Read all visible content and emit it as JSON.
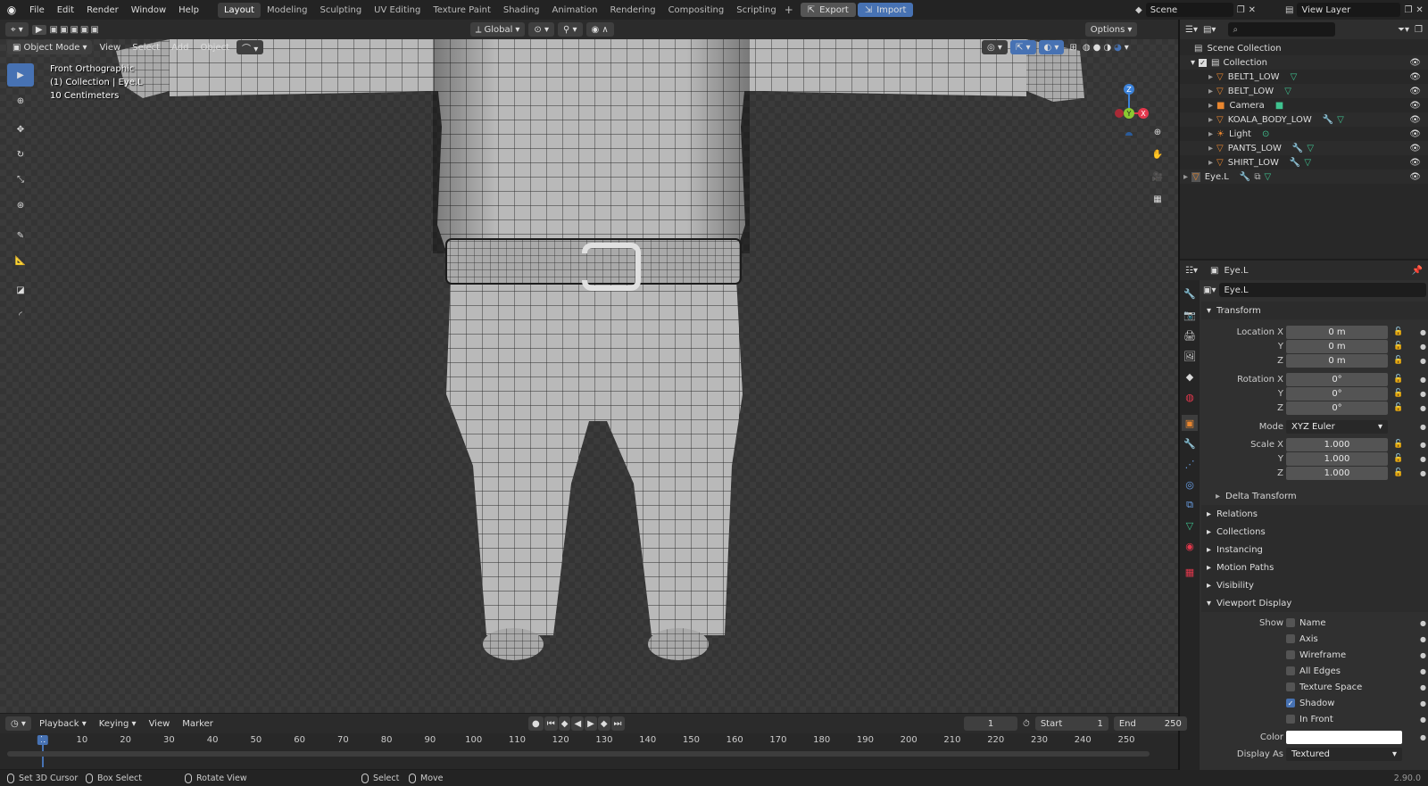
{
  "topbar": {
    "menus": [
      "File",
      "Edit",
      "Render",
      "Window",
      "Help"
    ],
    "workspaces": [
      "Layout",
      "Modeling",
      "Sculpting",
      "UV Editing",
      "Texture Paint",
      "Shading",
      "Animation",
      "Rendering",
      "Compositing",
      "Scripting"
    ],
    "active_workspace": "Layout",
    "export_label": "Export",
    "import_label": "Import",
    "scene_name": "Scene",
    "view_layer": "View Layer"
  },
  "viewport": {
    "mode": "Object Mode",
    "menus": [
      "View",
      "Select",
      "Add",
      "Object"
    ],
    "transform_orientation": "Global",
    "options_label": "Options",
    "overlay_lines": [
      "Front Orthographic",
      "(1) Collection | Eye.L",
      "10 Centimeters"
    ],
    "gizmo": {
      "z": "Z",
      "y": "Y",
      "x": "X"
    }
  },
  "outliner": {
    "root": "Scene Collection",
    "collection": "Collection",
    "items": [
      "BELT1_LOW",
      "BELT_LOW",
      "Camera",
      "KOALA_BODY_LOW",
      "Light",
      "PANTS_LOW",
      "SHIRT_LOW"
    ],
    "extra": "Eye.L"
  },
  "properties": {
    "object_name": "Eye.L",
    "name_field": "Eye.L",
    "transform_title": "Transform",
    "location": {
      "label": "Location X",
      "x": "0 m",
      "y": "0 m",
      "z": "0 m"
    },
    "rotation": {
      "label": "Rotation X",
      "x": "0°",
      "y": "0°",
      "z": "0°"
    },
    "mode_label": "Mode",
    "mode_value": "XYZ Euler",
    "scale": {
      "label": "Scale X",
      "x": "1.000",
      "y": "1.000",
      "z": "1.000"
    },
    "axis_y": "Y",
    "axis_z": "Z",
    "delta": "Delta Transform",
    "sections": [
      "Relations",
      "Collections",
      "Instancing",
      "Motion Paths",
      "Visibility"
    ],
    "viewport_display": "Viewport Display",
    "show_label": "Show",
    "show_options": [
      {
        "label": "Name",
        "checked": false
      },
      {
        "label": "Axis",
        "checked": false
      },
      {
        "label": "Wireframe",
        "checked": false
      },
      {
        "label": "All Edges",
        "checked": false
      },
      {
        "label": "Texture Space",
        "checked": false
      },
      {
        "label": "Shadow",
        "checked": true
      },
      {
        "label": "In Front",
        "checked": false
      }
    ],
    "color_label": "Color",
    "display_as_label": "Display As",
    "display_as_value": "Textured"
  },
  "timeline": {
    "menus": [
      "Playback",
      "Keying",
      "View",
      "Marker"
    ],
    "current_frame": "1",
    "start_label": "Start",
    "start_value": "1",
    "end_label": "End",
    "end_value": "250",
    "ticks": [
      "1",
      "10",
      "20",
      "30",
      "40",
      "50",
      "60",
      "70",
      "80",
      "90",
      "100",
      "110",
      "120",
      "130",
      "140",
      "150",
      "160",
      "170",
      "180",
      "190",
      "200",
      "210",
      "220",
      "230",
      "240",
      "250"
    ]
  },
  "statusbar": {
    "items": [
      "Set 3D Cursor",
      "Box Select",
      "Rotate View",
      "Select",
      "Move"
    ],
    "version": "2.90.0"
  },
  "colors": {
    "accent": "#4772b3",
    "gizmo_x": "#e3384d",
    "gizmo_y": "#8bc931",
    "gizmo_z": "#3c82d9",
    "object_orange": "#e8862f",
    "mesh_green": "#3fc28f"
  }
}
